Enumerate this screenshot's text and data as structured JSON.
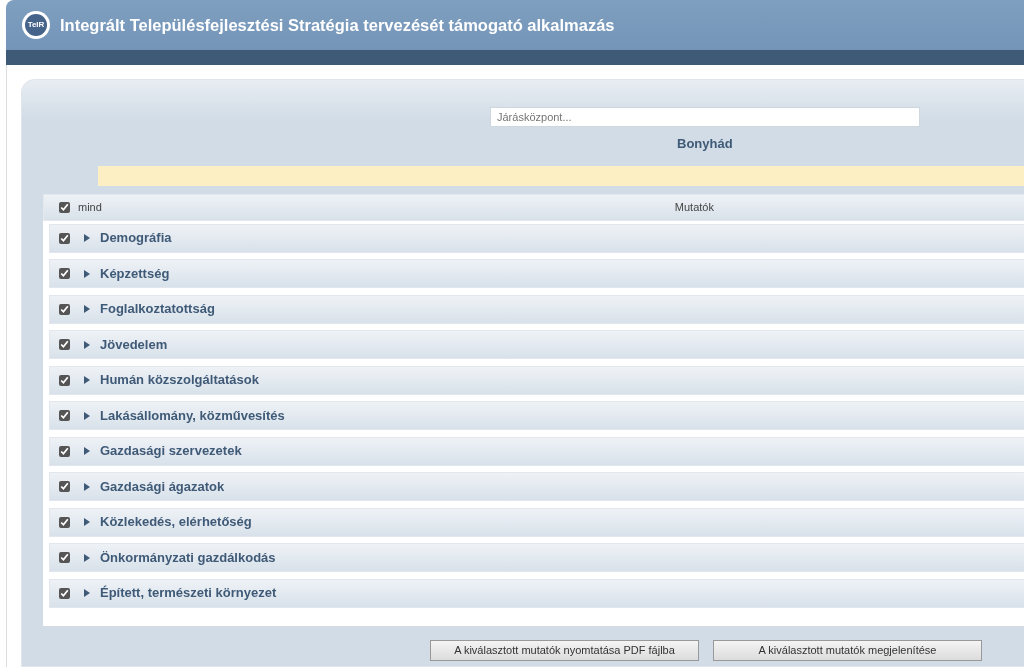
{
  "header": {
    "title": "Integrált Településfejlesztési Stratégia tervezését támogató alkalmazás",
    "logo_text": "TeIR"
  },
  "search": {
    "placeholder": "Járásközpont..."
  },
  "selected_place": "Bonyhád",
  "table": {
    "select_all": {
      "label": "mind",
      "checked": true
    },
    "column_title": "Mutatók",
    "rows": [
      {
        "label": "Demográfia",
        "checked": true,
        "expanded": false
      },
      {
        "label": "Képzettség",
        "checked": true,
        "expanded": false
      },
      {
        "label": "Foglalkoztatottság",
        "checked": true,
        "expanded": false
      },
      {
        "label": "Jövedelem",
        "checked": true,
        "expanded": false
      },
      {
        "label": "Humán közszolgáltatások",
        "checked": true,
        "expanded": false
      },
      {
        "label": "Lakásállomány, közművesítés",
        "checked": true,
        "expanded": false
      },
      {
        "label": "Gazdasági szervezetek",
        "checked": true,
        "expanded": false
      },
      {
        "label": "Gazdasági ágazatok",
        "checked": true,
        "expanded": false
      },
      {
        "label": "Közlekedés, elérhetőség",
        "checked": true,
        "expanded": false
      },
      {
        "label": "Önkormányzati gazdálkodás",
        "checked": true,
        "expanded": false
      },
      {
        "label": "Épített, természeti környezet",
        "checked": true,
        "expanded": false
      }
    ]
  },
  "buttons": [
    "A kiválasztott mutatók nyomtatása PDF fájlba",
    "A kiválasztott mutatók megjelenítése"
  ]
}
